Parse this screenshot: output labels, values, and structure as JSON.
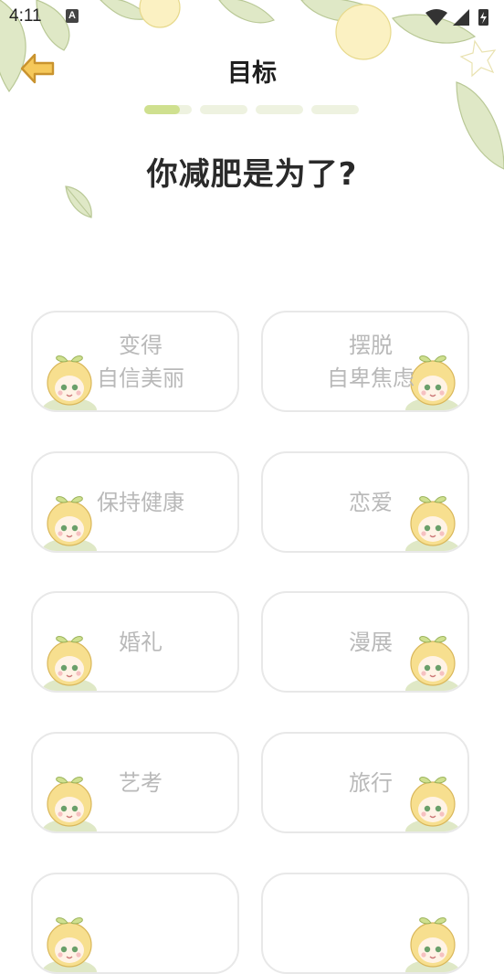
{
  "status": {
    "time": "4:11",
    "a_badge": "A"
  },
  "header": {
    "title": "目标"
  },
  "progress": {
    "total_steps": 4,
    "current_step": 1,
    "current_fill": 0.75
  },
  "question": "你减肥是为了?",
  "options": [
    {
      "label": "变得\n自信美丽"
    },
    {
      "label": "摆脱\n自卑焦虑"
    },
    {
      "label": "保持健康"
    },
    {
      "label": "恋爱"
    },
    {
      "label": "婚礼"
    },
    {
      "label": "漫展"
    },
    {
      "label": "艺考"
    },
    {
      "label": "旅行"
    },
    {
      "label": ""
    },
    {
      "label": ""
    }
  ],
  "colors": {
    "accent_green": "#cfe08f",
    "card_border": "#e8e8e8",
    "label_gray": "#b9b9b9",
    "back_arrow": "#f5c85a"
  }
}
